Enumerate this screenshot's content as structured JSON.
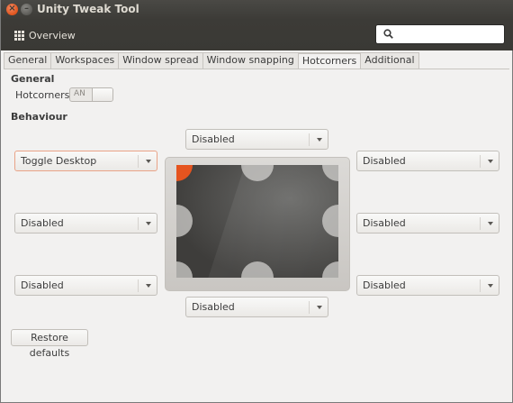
{
  "window": {
    "title": "Unity Tweak Tool"
  },
  "toolbar": {
    "overview_label": "Overview",
    "search_placeholder": ""
  },
  "tabs": [
    {
      "label": "General",
      "active": false
    },
    {
      "label": "Workspaces",
      "active": false
    },
    {
      "label": "Window spread",
      "active": false
    },
    {
      "label": "Window snapping",
      "active": false
    },
    {
      "label": "Hotcorners",
      "active": true
    },
    {
      "label": "Additional",
      "active": false
    }
  ],
  "general": {
    "heading": "General",
    "hotcorners_label": "Hotcorners:",
    "hotcorners_switch": "AN"
  },
  "behaviour": {
    "heading": "Behaviour",
    "top": "Disabled",
    "top_left": "Toggle Desktop",
    "top_right": "Disabled",
    "left": "Disabled",
    "right": "Disabled",
    "bottom_left": "Disabled",
    "bottom_right": "Disabled",
    "bottom": "Disabled"
  },
  "restore_label": "Restore defaults",
  "colors": {
    "accent": "#e5541f",
    "titlebar": "#3c3b37"
  },
  "icons": {
    "close": "close-icon",
    "minimize": "minimize-icon",
    "overview": "grid-icon",
    "search": "search-icon"
  }
}
